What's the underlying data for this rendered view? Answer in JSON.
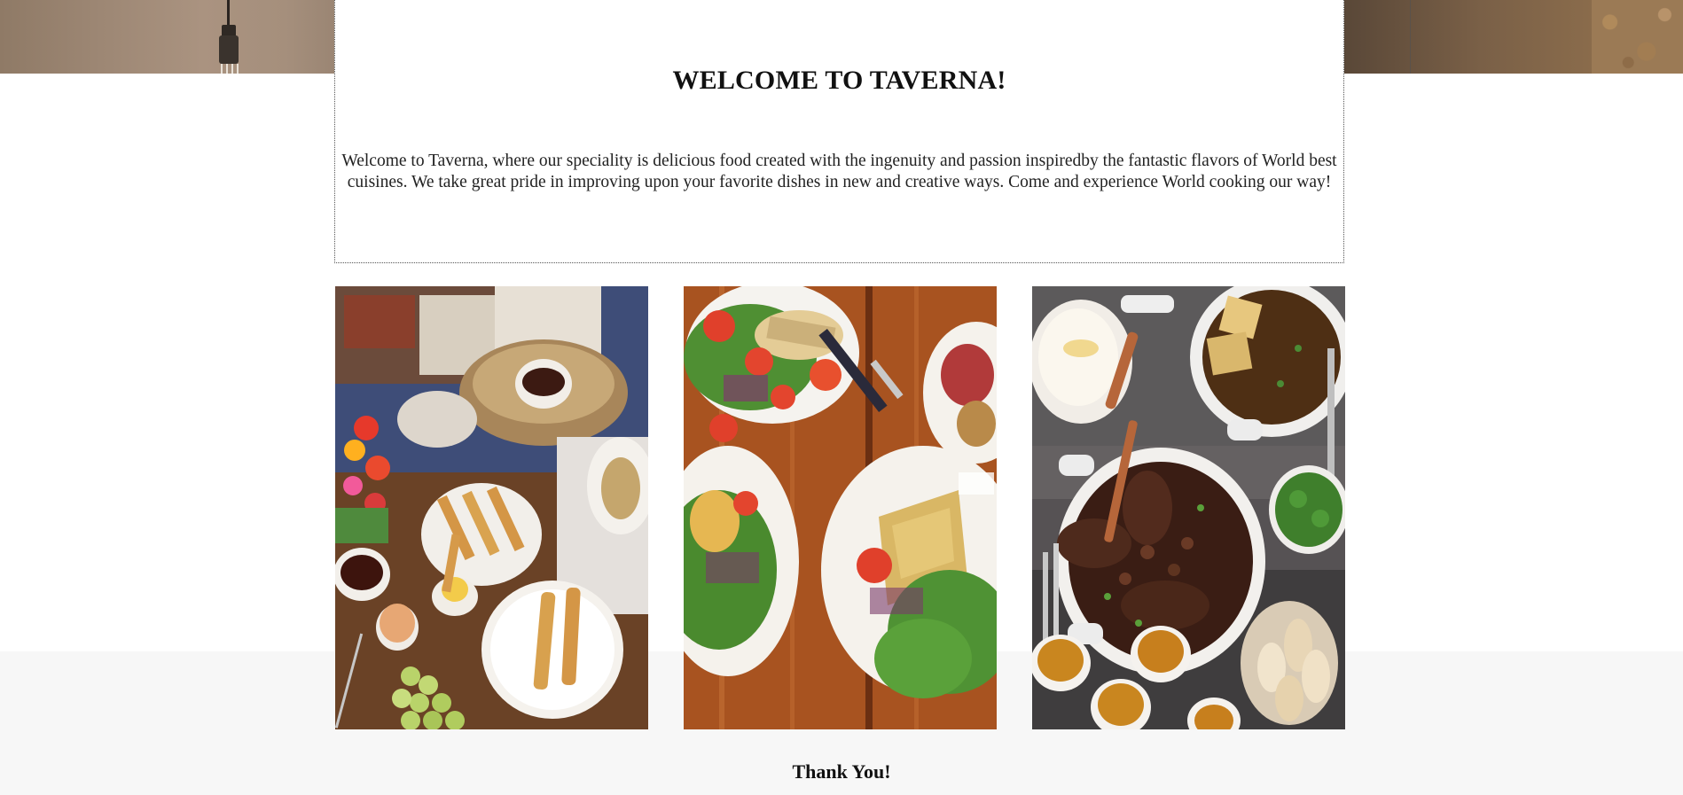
{
  "welcome": {
    "title": "WELCOME TO TAVERNA!",
    "body": "Welcome to Taverna, where our speciality is delicious food created with the ingenuity and passion inspiredby the fantastic flavors of World best cuisines. We take great pride in improving upon your favorite dishes in new and creative ways. Come and experience World cooking our way!"
  },
  "gallery": {
    "photos": [
      {
        "name": "breakfast-table-photo",
        "subject": "breakfast with tea, eggs, toast soldiers, grapes and flowers"
      },
      {
        "name": "salad-and-quiche-photo",
        "subject": "salads with tomatoes and quiche on wooden table"
      },
      {
        "name": "stew-dinner-photo",
        "subject": "pot of stew, soup, mashed potatoes, creme brulee and bread"
      }
    ]
  },
  "footer": {
    "thank_you": "Thank You!"
  },
  "colors": {
    "background": "#ffffff",
    "footer_band": "#f7f7f7",
    "text": "#111111",
    "box_border": "#555555"
  }
}
